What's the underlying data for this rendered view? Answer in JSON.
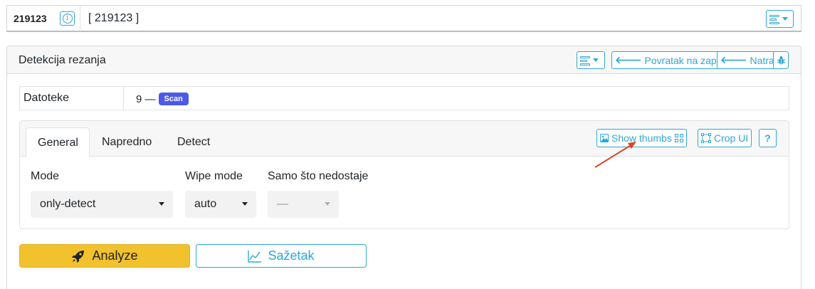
{
  "header": {
    "record_id": "219123",
    "record_title": "[ 219123 ]",
    "info_icon": "info-circle-icon",
    "menu_icon": "stack-menu-icon"
  },
  "panel": {
    "title": "Detekcija rezanja",
    "back_to_record_label": "Povratak na zapis",
    "back_label": "Natrag",
    "debug_icon": "bug-icon"
  },
  "files": {
    "label": "Datoteke",
    "count_text": "9 —",
    "badge": "Scan"
  },
  "tabs": [
    {
      "label": "General",
      "active": true
    },
    {
      "label": "Napredno",
      "active": false
    },
    {
      "label": "Detect",
      "active": false
    }
  ],
  "tools": {
    "show_thumbs_label": "Show thumbs",
    "crop_ui_label": "Crop UI",
    "help_label": "?"
  },
  "form": {
    "mode_label": "Mode",
    "mode_value": "only-detect",
    "wipe_label": "Wipe mode",
    "wipe_value": "auto",
    "missing_label": "Samo što nedostaje",
    "missing_value": "—"
  },
  "actions": {
    "analyze_label": "Analyze",
    "summary_label": "Sažetak"
  },
  "colors": {
    "accent": "#2ea7d8",
    "analyze_bg": "#f2c12e",
    "badge_bg": "#4b5ae8",
    "annotation_arrow": "#e0442a"
  }
}
